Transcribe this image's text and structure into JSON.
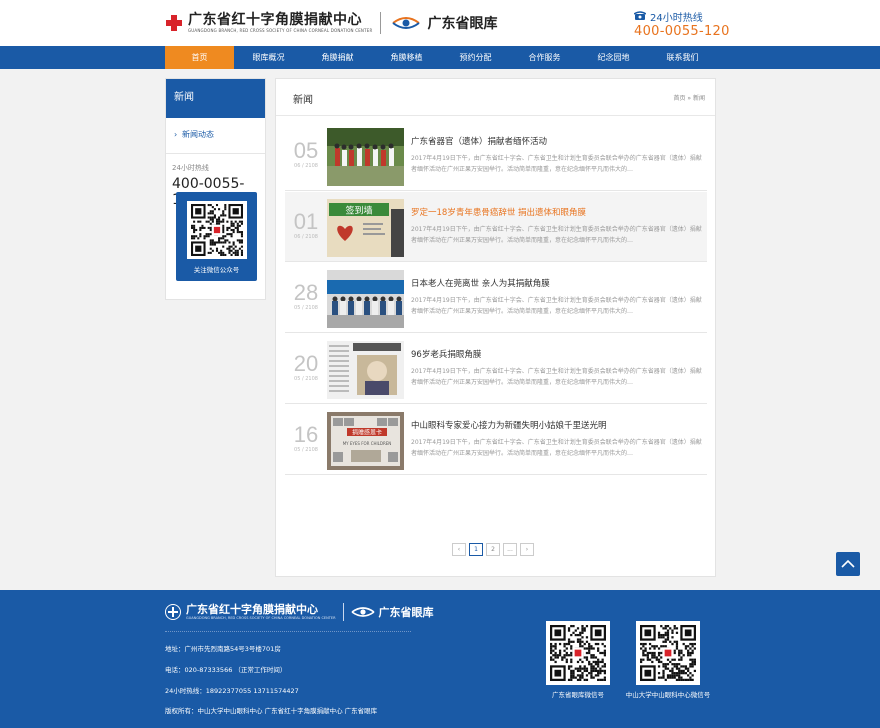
{
  "header": {
    "logo_cn": "广东省红十字角膜捐献中心",
    "logo_en": "GUANGDONG BRANCH, RED CROSS SOCIETY OF CHINA CORNEAL DONATION CENTER",
    "bank_name": "广东省眼库",
    "hotline_label": "24小时热线",
    "hotline_number": "400-0055-120"
  },
  "nav": {
    "items": [
      {
        "label": "首页"
      },
      {
        "label": "眼库概况"
      },
      {
        "label": "角膜捐献"
      },
      {
        "label": "角膜移植"
      },
      {
        "label": "预约分配"
      },
      {
        "label": "合作服务"
      },
      {
        "label": "纪念园地"
      },
      {
        "label": "联系我们"
      }
    ]
  },
  "sidebar": {
    "title": "新闻",
    "items": [
      {
        "label": "新闻动态"
      }
    ],
    "hotline_label": "24小时热线",
    "hotline_number": "400-0055-120",
    "qr_label": "关注微信公众号"
  },
  "main": {
    "title": "新闻",
    "breadcrumb": "首页 » 新闻",
    "news": [
      {
        "day": "05",
        "ym": "06 / 2108",
        "title": "广东省器官（遗体）捐献者缅怀活动",
        "desc": "2017年4月19日下午，由广东省红十字会、广东省卫生和计划生育委员会联合举办的广东省器官（遗体）捐献者缅怀活动在广州正果万安园举行。活动简单而隆重，意在纪念缅怀平凡而伟大的…"
      },
      {
        "day": "01",
        "ym": "06 / 2108",
        "title": "罗定一18岁青年患骨癌辞世 捐出遗体和眼角膜",
        "desc": "2017年4月19日下午，由广东省红十字会、广东省卫生和计划生育委员会联合举办的广东省器官（遗体）捐献者缅怀活动在广州正果万安园举行。活动简单而隆重，意在纪念缅怀平凡而伟大的…"
      },
      {
        "day": "28",
        "ym": "05 / 2108",
        "title": "日本老人在莞离世 亲人为其捐献角膜",
        "desc": "2017年4月19日下午，由广东省红十字会、广东省卫生和计划生育委员会联合举办的广东省器官（遗体）捐献者缅怀活动在广州正果万安园举行。活动简单而隆重，意在纪念缅怀平凡而伟大的…"
      },
      {
        "day": "20",
        "ym": "05 / 2108",
        "title": "96岁老兵捐眼角膜",
        "desc": "2017年4月19日下午，由广东省红十字会、广东省卫生和计划生育委员会联合举办的广东省器官（遗体）捐献者缅怀活动在广州正果万安园举行。活动简单而隆重，意在纪念缅怀平凡而伟大的…"
      },
      {
        "day": "16",
        "ym": "05 / 2108",
        "title": "中山眼科专家爱心接力为新疆失明小姑娘千里送光明",
        "desc": "2017年4月19日下午，由广东省红十字会、广东省卫生和计划生育委员会联合举办的广东省器官（遗体）捐献者缅怀活动在广州正果万安园举行。活动简单而隆重，意在纪念缅怀平凡而伟大的…"
      }
    ],
    "thumb_texts": {
      "sign": "签到墙",
      "card": "捐赠感恩卡",
      "card_en": "MY EYES FOR CHILDREN"
    },
    "pager": {
      "prev": "‹",
      "pages": [
        "1",
        "2"
      ],
      "ellipsis": "...",
      "next": "›"
    }
  },
  "footer": {
    "logo_cn": "广东省红十字角膜捐献中心",
    "logo_en": "GUANGDONG BRANCH, RED CROSS SOCIETY OF CHINA CORNEAL DONATION CENTER",
    "bank_name": "广东省眼库",
    "address": "地址：广州市先烈南路54号3号楼701房",
    "phone": "电话：020-87333566 （正常工作时间）",
    "hotline": "24小时热线：18922377055 13711574427",
    "copyright": "版权所有：中山大学中山眼科中心 广东省红十字角膜捐献中心 广东省眼库",
    "qr1_label": "广东省眼库微信号",
    "qr2_label": "中山大学中山眼科中心微信号"
  },
  "colors": {
    "brand_blue": "#1a5aa6",
    "accent_orange": "#ef8a20",
    "red_cross": "#d8232a"
  }
}
